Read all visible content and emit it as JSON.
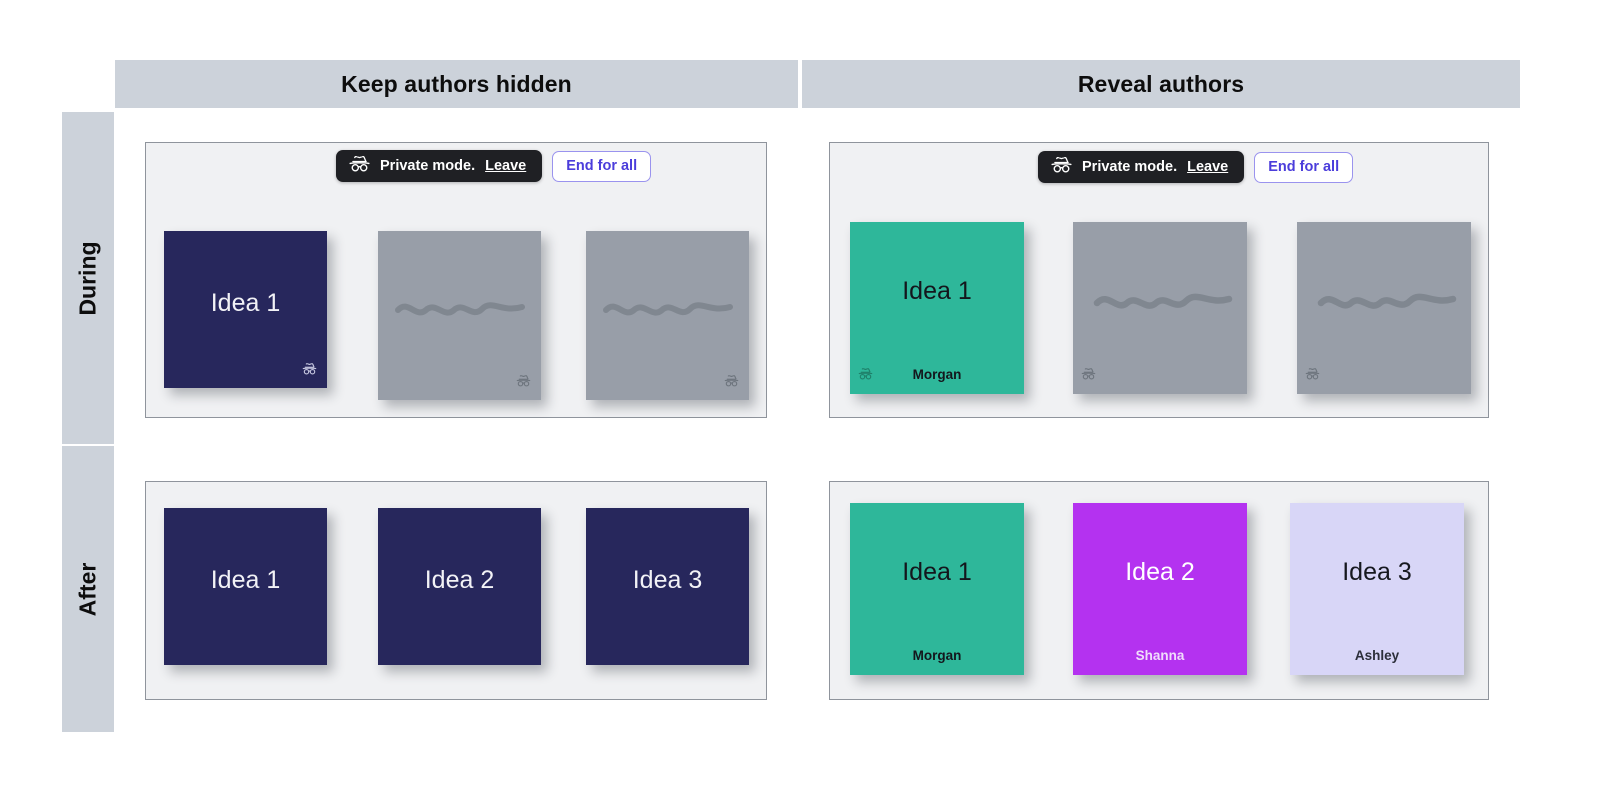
{
  "columns": [
    {
      "id": "hidden",
      "label": "Keep authors hidden"
    },
    {
      "id": "reveal",
      "label": "Reveal authors"
    }
  ],
  "rows": [
    {
      "id": "during",
      "label": "During"
    },
    {
      "id": "after",
      "label": "After"
    }
  ],
  "toolbar": {
    "badge_icon": "incognito-icon",
    "badge_text": "Private mode.",
    "leave_label": "Leave",
    "end_label": "End for all"
  },
  "panels": {
    "during_hidden": {
      "cards": [
        {
          "title": "Idea 1",
          "author": "",
          "color": "navy",
          "style": "navy",
          "icon": "incognito-icon",
          "icon_pos": "bottom-right",
          "scribble": false
        },
        {
          "title": "",
          "author": "",
          "color": "gray",
          "style": "gray",
          "icon": "incognito-icon",
          "icon_pos": "bottom-right",
          "scribble": true
        },
        {
          "title": "",
          "author": "",
          "color": "gray",
          "style": "gray",
          "icon": "incognito-icon",
          "icon_pos": "bottom-right",
          "scribble": true
        }
      ]
    },
    "during_reveal": {
      "cards": [
        {
          "title": "Idea 1",
          "author": "Morgan",
          "color": "teal",
          "style": "teal",
          "icon": "incognito-icon",
          "icon_pos": "bottom-left",
          "scribble": false
        },
        {
          "title": "",
          "author": "",
          "color": "gray",
          "style": "gray",
          "icon": "incognito-icon",
          "icon_pos": "bottom-left",
          "scribble": true
        },
        {
          "title": "",
          "author": "",
          "color": "gray",
          "style": "gray",
          "icon": "incognito-icon",
          "icon_pos": "bottom-left",
          "scribble": true
        }
      ]
    },
    "after_hidden": {
      "cards": [
        {
          "title": "Idea 1",
          "author": "",
          "color": "navy",
          "style": "navy",
          "icon": "",
          "icon_pos": "",
          "scribble": false
        },
        {
          "title": "Idea 2",
          "author": "",
          "color": "navy",
          "style": "navy",
          "icon": "",
          "icon_pos": "",
          "scribble": false
        },
        {
          "title": "Idea 3",
          "author": "",
          "color": "navy",
          "style": "navy",
          "icon": "",
          "icon_pos": "",
          "scribble": false
        }
      ]
    },
    "after_reveal": {
      "cards": [
        {
          "title": "Idea 1",
          "author": "Morgan",
          "color": "teal",
          "style": "teal",
          "icon": "",
          "icon_pos": "",
          "scribble": false
        },
        {
          "title": "Idea 2",
          "author": "Shanna",
          "color": "magenta",
          "style": "magenta",
          "icon": "",
          "icon_pos": "",
          "scribble": false
        },
        {
          "title": "Idea 3",
          "author": "Ashley",
          "color": "lavender",
          "style": "lavender",
          "icon": "",
          "icon_pos": "",
          "scribble": false
        }
      ]
    }
  },
  "colors": {
    "header_bar": "#ccd2da",
    "panel_bg": "#f0f1f3",
    "panel_border": "#8f949c",
    "navy": "#27275c",
    "gray_card": "#989ea8",
    "teal": "#2eb79a",
    "magenta": "#b432f0",
    "lavender": "#d8d6f7",
    "badge_bg": "#1f2024",
    "accent_purple": "#4b3ddb"
  }
}
